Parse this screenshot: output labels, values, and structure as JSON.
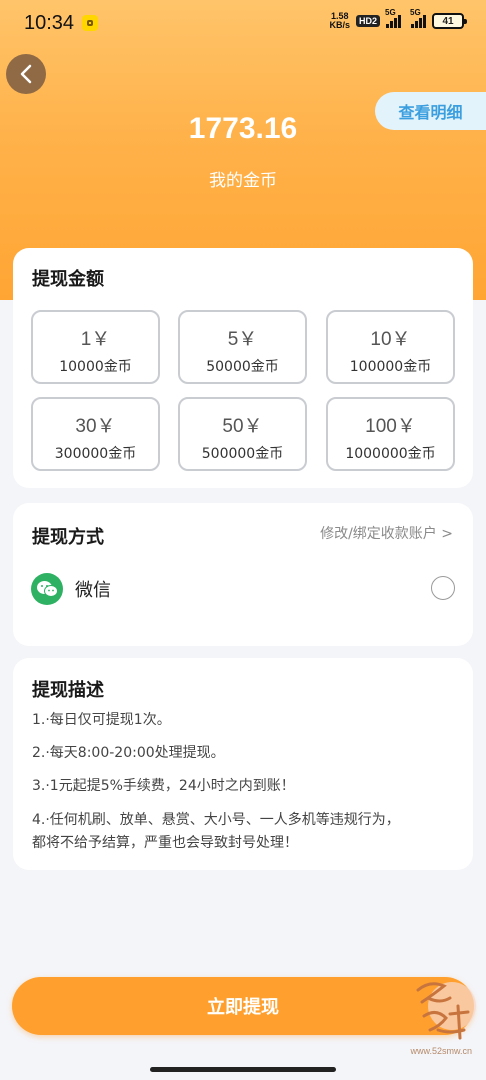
{
  "status_bar": {
    "time": "10:34",
    "speed_value": "1.58",
    "speed_unit": "KB/s",
    "hd_badge": "HD2",
    "network_1": "5G",
    "network_2": "5G",
    "battery": "41"
  },
  "header": {
    "detail_button": "查看明细",
    "coin_amount": "1773.16",
    "coin_label": "我的金币",
    "hero_color": "#ffa534"
  },
  "amount_section": {
    "title": "提现金额",
    "options": [
      {
        "amount": "1￥",
        "coins": "10000金币"
      },
      {
        "amount": "5￥",
        "coins": "50000金币"
      },
      {
        "amount": "10￥",
        "coins": "100000金币"
      },
      {
        "amount": "30￥",
        "coins": "300000金币"
      },
      {
        "amount": "50￥",
        "coins": "500000金币"
      },
      {
        "amount": "100￥",
        "coins": "1000000金币"
      }
    ]
  },
  "method_section": {
    "title": "提现方式",
    "modify_link": "修改/绑定收款账户 >",
    "wechat_label": "微信",
    "wechat_color": "#2fb163"
  },
  "description_section": {
    "title": "提现描述",
    "lines": [
      "1.·每日仅可提现1次。",
      "2.·每天8:00-20:00处理提现。",
      "3.·1元起提5%手续费，24小时之内到账！",
      "4.·任何机刷、放单、悬赏、大小号、一人多机等违规行为，",
      "都将不给予结算，严重也会导致封号处理！"
    ]
  },
  "submit_button": "立即提现",
  "watermark": {
    "url": "www.52smw.cn"
  }
}
